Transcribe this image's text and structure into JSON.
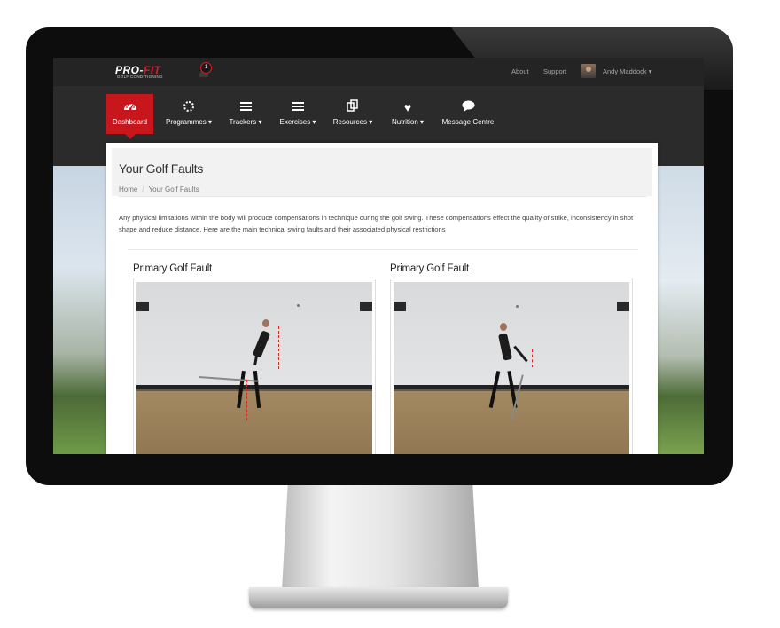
{
  "topbar": {
    "logo_main_a": "PRO-",
    "logo_main_b": "FIT",
    "logo_sub": "GOLF CONDITIONING",
    "notification_count": "1",
    "about": "About",
    "support": "Support",
    "user_name": "Andy Maddock ▾"
  },
  "nav": [
    {
      "label": "Dashboard",
      "icon": "dashboard-gauge-icon"
    },
    {
      "label": "Programmes ▾",
      "icon": "spinner-icon"
    },
    {
      "label": "Trackers ▾",
      "icon": "list-bars-icon"
    },
    {
      "label": "Exercises ▾",
      "icon": "list-bars-icon"
    },
    {
      "label": "Resources ▾",
      "icon": "documents-icon"
    },
    {
      "label": "Nutrition ▾",
      "icon": "heart-icon"
    },
    {
      "label": "Message Centre",
      "icon": "speech-bubble-icon"
    }
  ],
  "page": {
    "title": "Your Golf Faults",
    "breadcrumb": [
      "Home",
      "Your Golf Faults"
    ],
    "intro": "Any physical limitations within the body will produce compensations in technique during the golf swing. These compensations effect the quality of strike, inconsistency in shot shape and reduce distance. Here are the main technical swing faults and their associated physical restrictions"
  },
  "faults": [
    {
      "title": "Primary Golf Fault"
    },
    {
      "title": "Primary Golf Fault"
    }
  ],
  "colors": {
    "accent": "#c8161d",
    "nav_bg": "#2b2b2b",
    "topbar_bg": "#242424"
  }
}
